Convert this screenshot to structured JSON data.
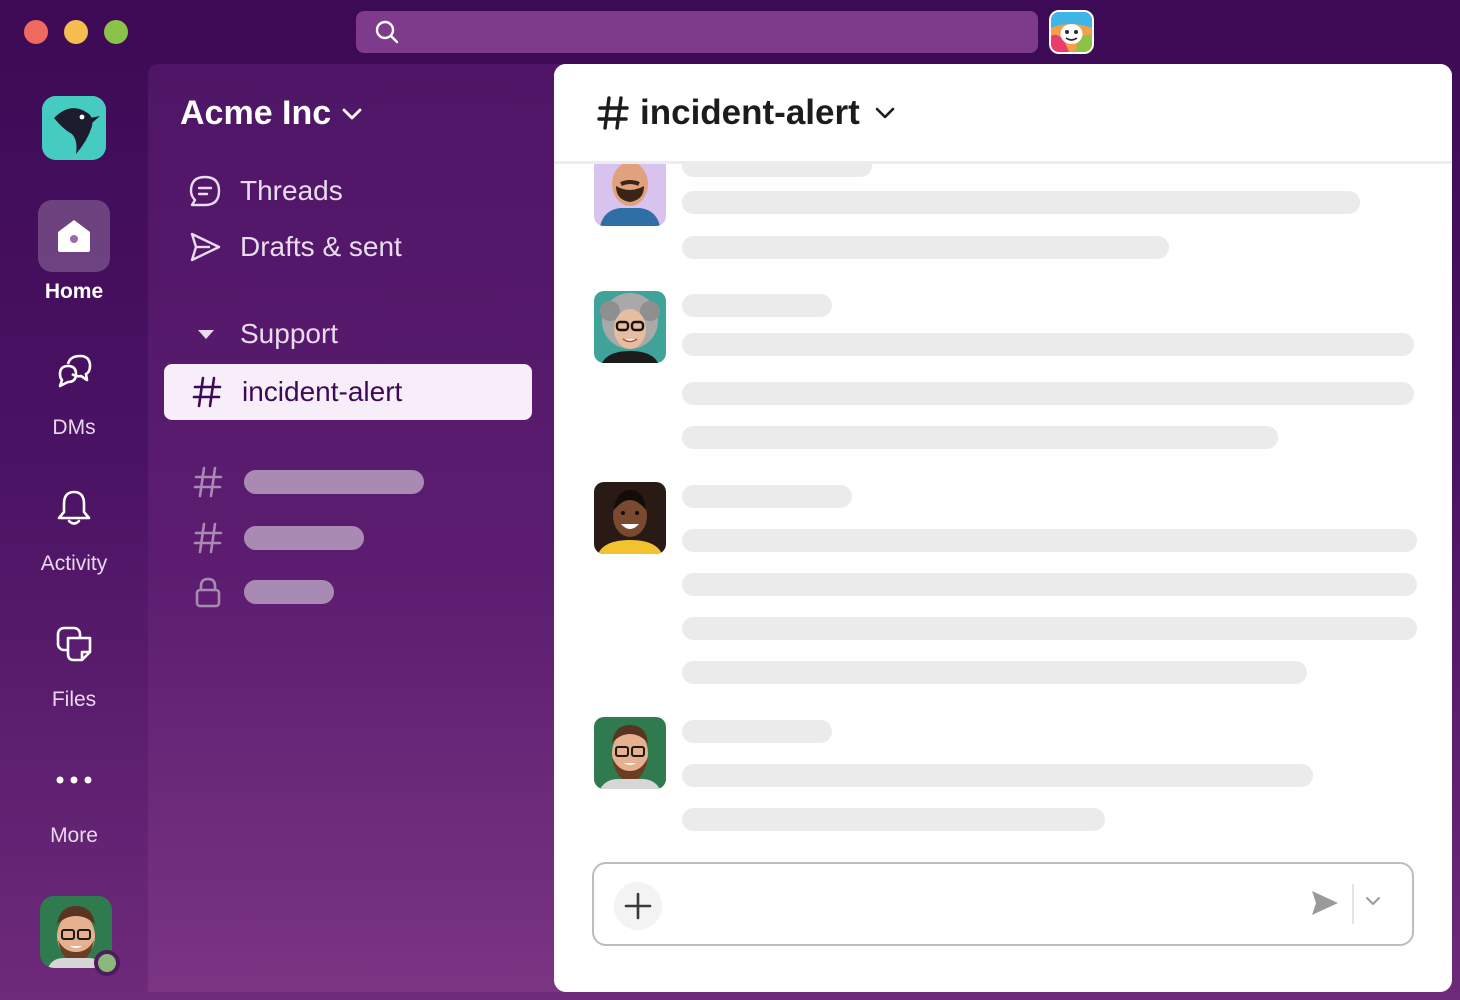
{
  "window": {
    "controls": [
      "close",
      "minimize",
      "maximize"
    ]
  },
  "search": {
    "icon": "search-icon"
  },
  "app_badge": {
    "icon": "app-badge-icon"
  },
  "rail": {
    "workspace_logo": "bird-logo-icon",
    "items": [
      {
        "label": "Home",
        "icon": "home-icon",
        "active": true
      },
      {
        "label": "DMs",
        "icon": "dms-icon",
        "active": false
      },
      {
        "label": "Activity",
        "icon": "bell-icon",
        "active": false
      },
      {
        "label": "Files",
        "icon": "files-icon",
        "active": false
      },
      {
        "label": "More",
        "icon": "more-icon",
        "active": false
      }
    ],
    "user": {
      "status": "online"
    }
  },
  "sidebar": {
    "workspace_name": "Acme Inc",
    "nav": [
      {
        "label": "Threads",
        "icon": "threads-icon"
      },
      {
        "label": "Drafts & sent",
        "icon": "send-icon"
      }
    ],
    "section": {
      "label": "Support",
      "icon": "caret-down-icon"
    },
    "active_channel": {
      "label": "incident-alert",
      "icon": "hash-icon"
    },
    "placeholder_channels": [
      {
        "icon": "hash-icon"
      },
      {
        "icon": "hash-icon"
      },
      {
        "icon": "lock-icon"
      }
    ]
  },
  "channel": {
    "name": "incident-alert",
    "symbol": "#"
  },
  "messages": [
    {
      "avatar": "man-mustache"
    },
    {
      "avatar": "woman-gray-curly"
    },
    {
      "avatar": "woman-smiling"
    },
    {
      "avatar": "man-beard-glasses"
    }
  ],
  "composer": {
    "add_icon": "plus-icon",
    "send_icon": "send-icon",
    "options_icon": "chevron-down-icon"
  },
  "colors": {
    "rail_bg": "#3d0a55",
    "sidebar_bg": "#4f1566",
    "active_channel_bg": "#f7eefa",
    "skeleton": "#ebebeb",
    "accent": "#ffffff"
  }
}
